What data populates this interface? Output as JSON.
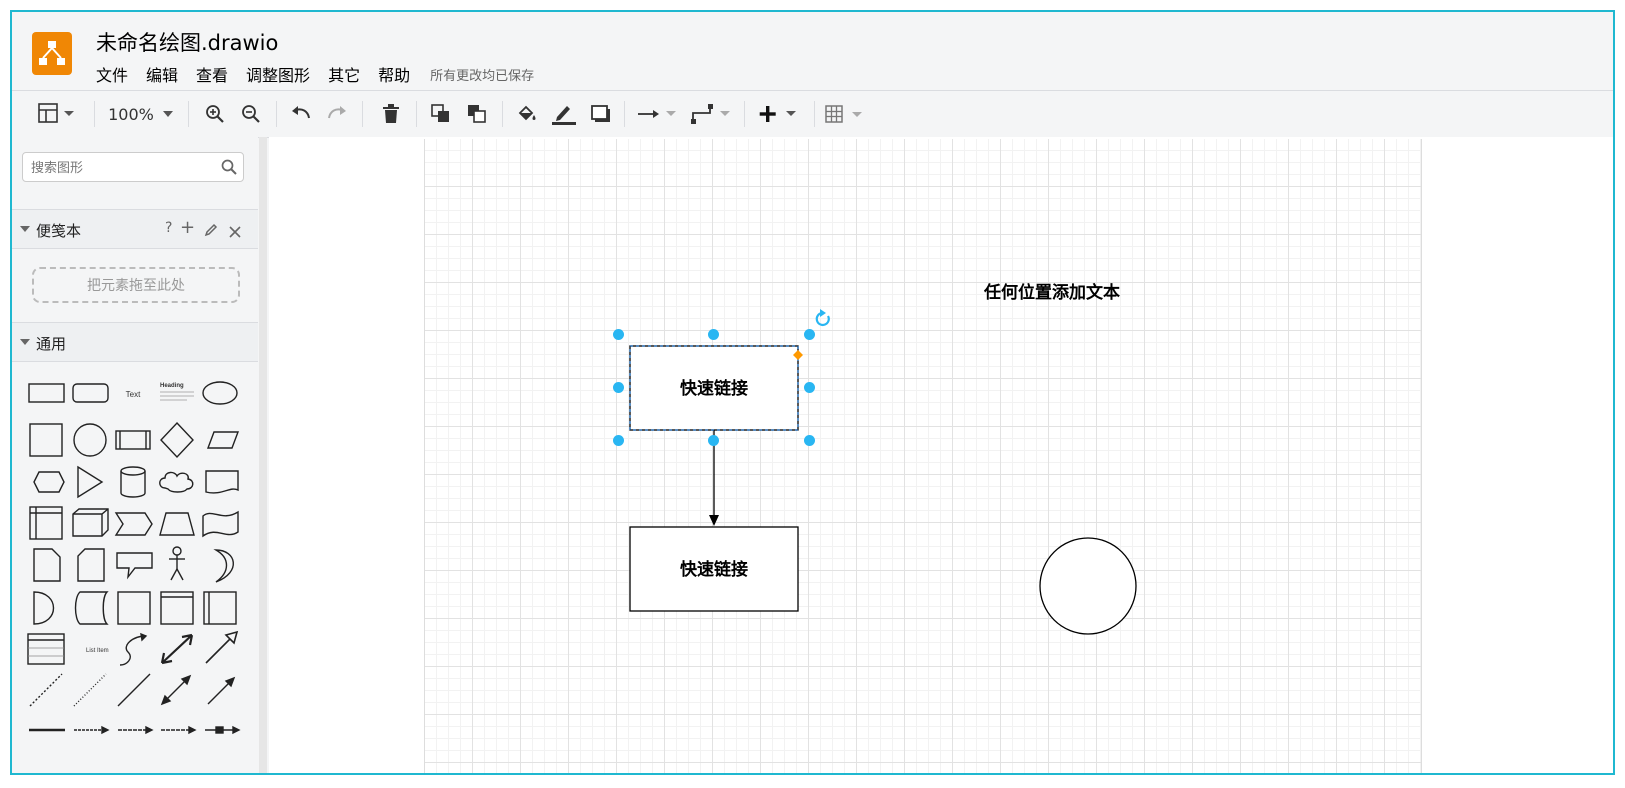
{
  "app": {
    "file_title": "未命名绘图.drawio",
    "save_status": "所有更改均已保存"
  },
  "menu": [
    "文件",
    "编辑",
    "查看",
    "调整图形",
    "其它",
    "帮助"
  ],
  "toolbar": {
    "zoom": "100%",
    "icons": [
      "format-panel-icon",
      "zoom-in-icon",
      "zoom-out-icon",
      "undo-icon",
      "redo-icon",
      "delete-icon",
      "to-front-icon",
      "to-back-icon",
      "fill-color-icon",
      "line-color-icon",
      "shadow-icon",
      "connection-icon",
      "waypoints-icon",
      "insert-icon",
      "table-icon"
    ]
  },
  "sidebar": {
    "search_placeholder": "搜索图形",
    "scratchpad": {
      "title": "便笺本",
      "help": "?",
      "add": "+",
      "drop_hint": "把元素拖至此处"
    },
    "general": {
      "title": "通用",
      "text_shape_label": "Text",
      "heading_shape_label": "Heading",
      "list_item_label": "List Item"
    }
  },
  "canvas": {
    "nodes": [
      {
        "label": "快速链接",
        "selected": true
      },
      {
        "label": "快速链接",
        "selected": false
      }
    ],
    "free_text": "任何位置添加文本"
  },
  "colors": {
    "accent": "#1fb8d0",
    "logo": "#f08705",
    "handle": "#29b6f2",
    "selection_dash": "#0066cc",
    "style_handle": "#ff9900"
  }
}
